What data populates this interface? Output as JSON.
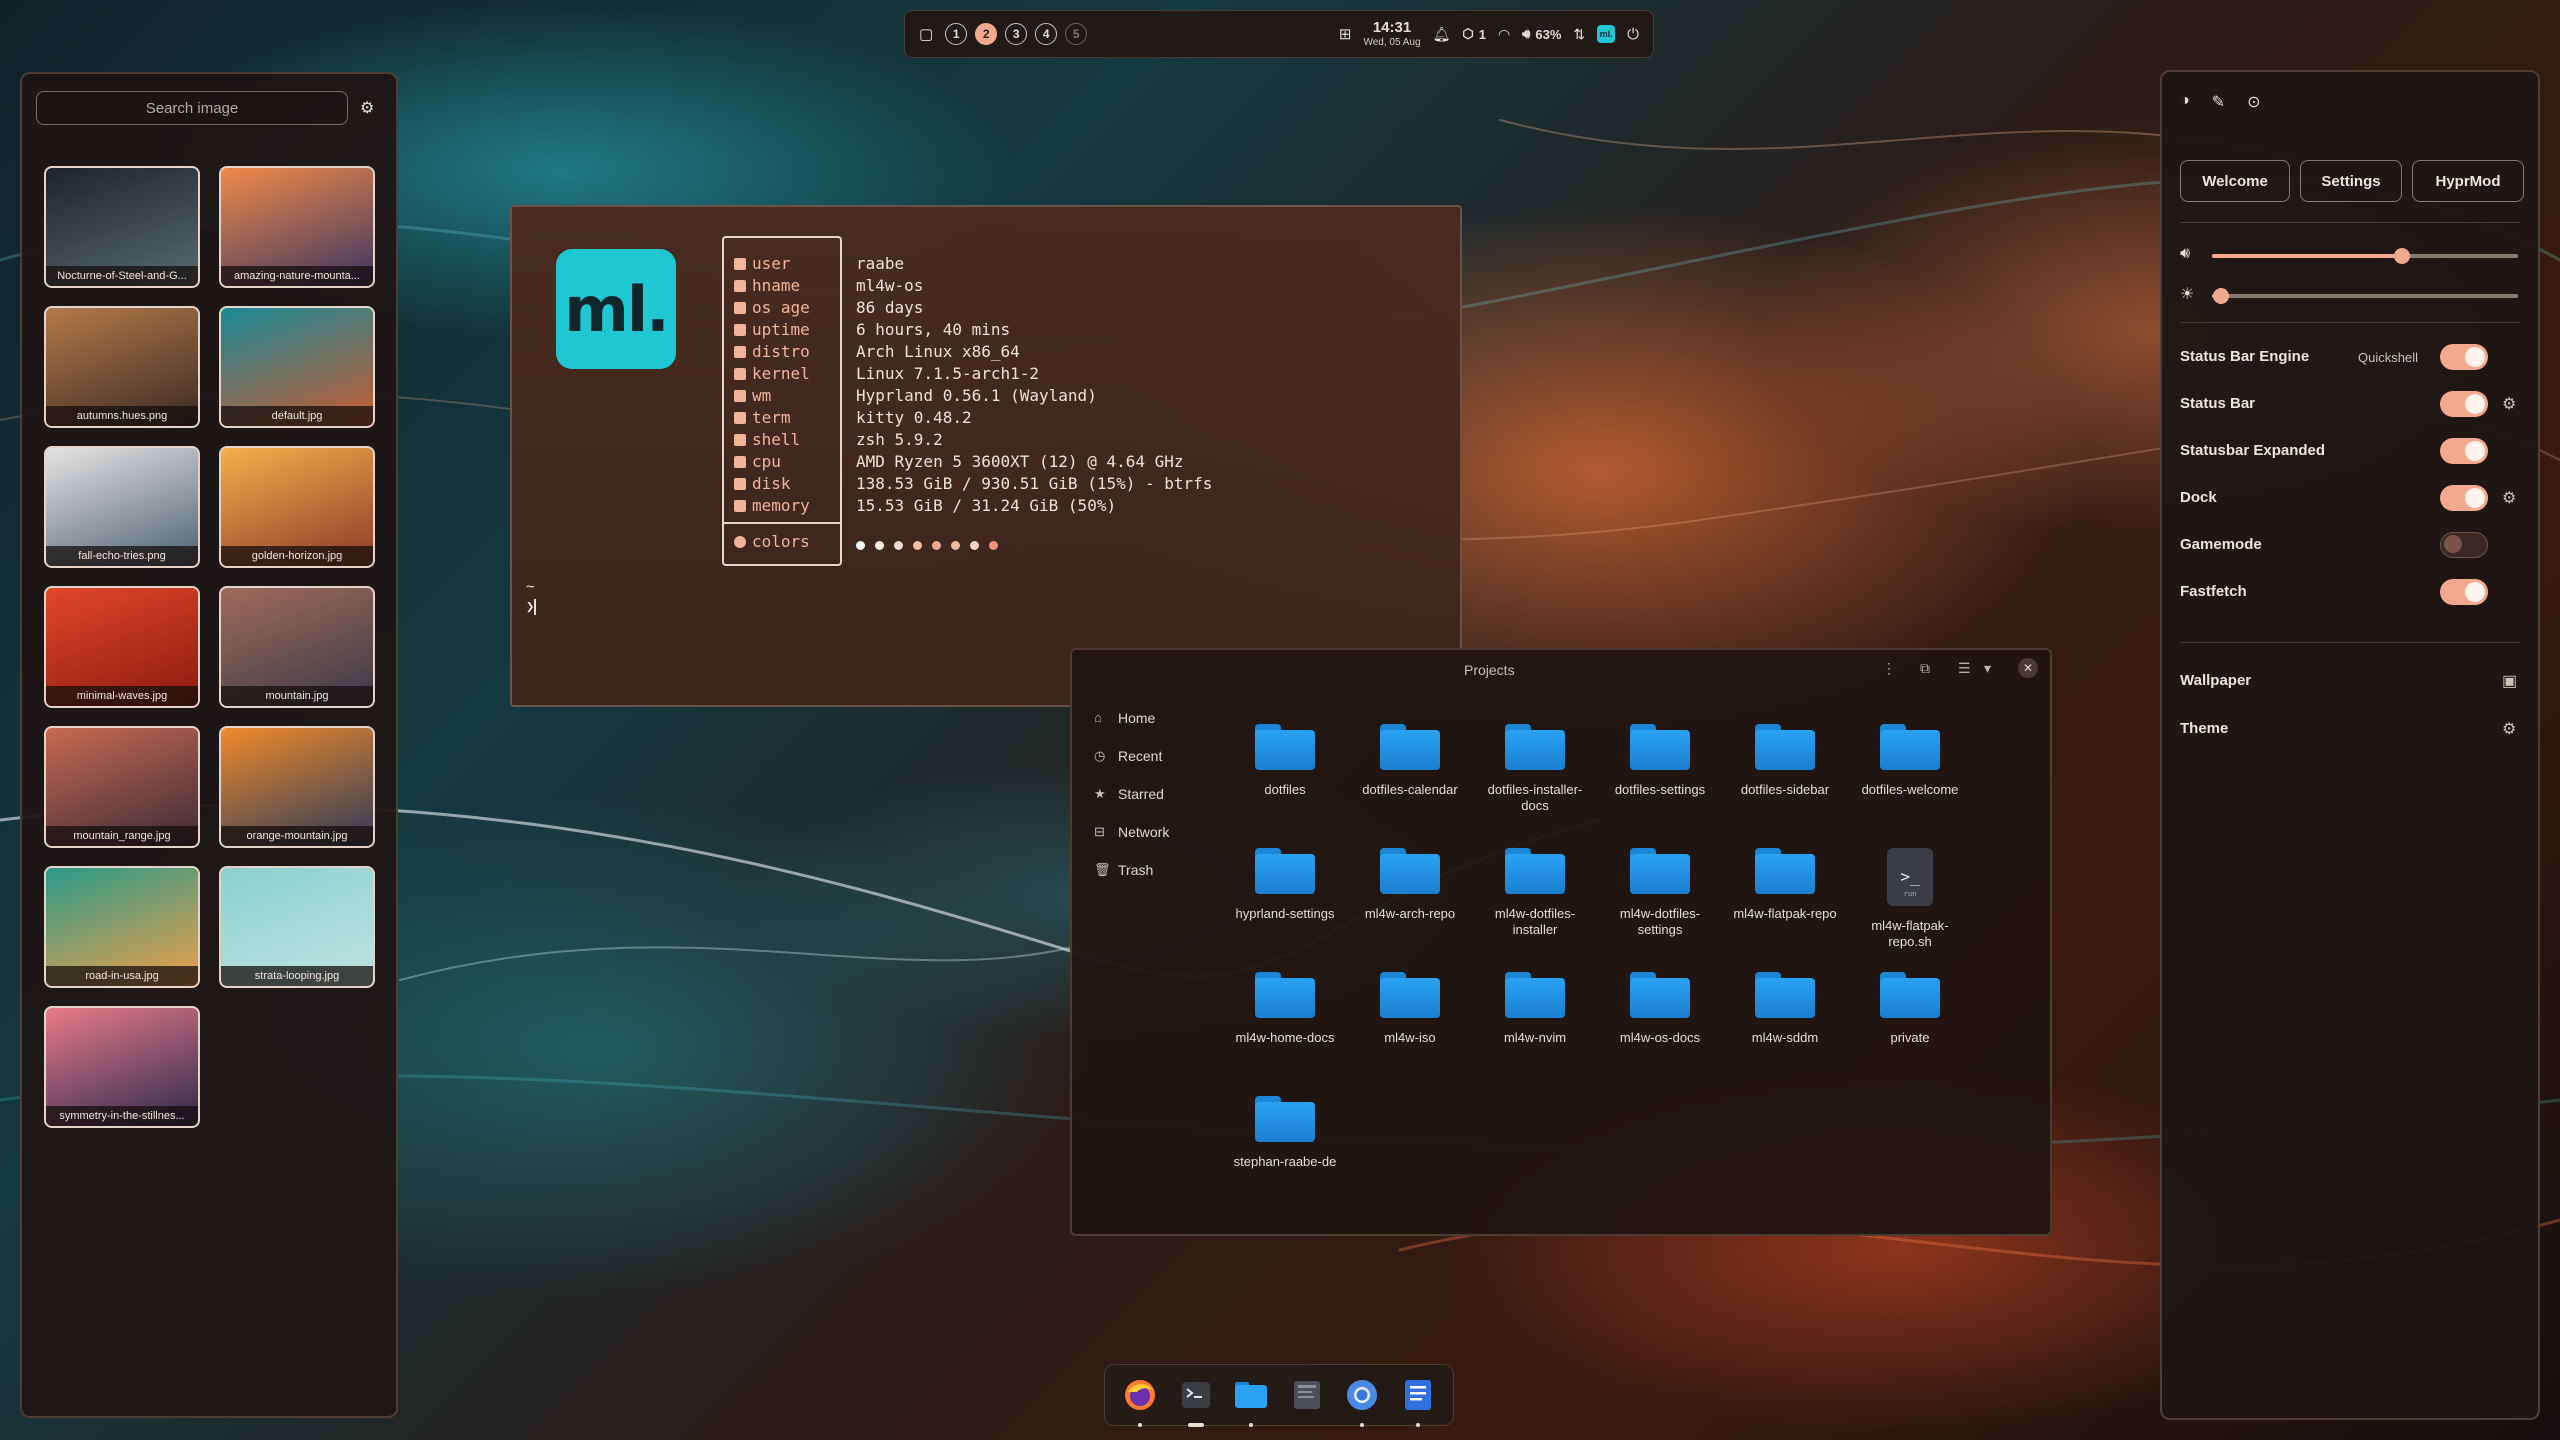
{
  "topbar": {
    "workspaces": [
      "1",
      "2",
      "3",
      "4",
      "5"
    ],
    "active_workspace": "2",
    "time": "14:31",
    "date": "Wed, 05 Aug",
    "updates": "1",
    "volume": "63%",
    "icons": [
      "window-icon",
      "apps-grid-icon",
      "bell-icon",
      "package-icon",
      "gauge-icon",
      "speaker-icon",
      "network-icon",
      "ml-logo-icon",
      "power-icon"
    ]
  },
  "wallpapers": {
    "search_placeholder": "Search image",
    "items": [
      {
        "name": "Nocturne-of-Steel-and-G...",
        "colors": [
          "#1d2428",
          "#5a6a72"
        ]
      },
      {
        "name": "amazing-nature-mounta...",
        "colors": [
          "#f08a4a",
          "#3b3560"
        ]
      },
      {
        "name": "autumns.hues.png",
        "colors": [
          "#b47a4a",
          "#3b2a22"
        ]
      },
      {
        "name": "default.jpg",
        "colors": [
          "#1a8a96",
          "#c85a30"
        ]
      },
      {
        "name": "fall-echo-tries.png",
        "colors": [
          "#e6e4e2",
          "#4e6070"
        ]
      },
      {
        "name": "golden-horizon.jpg",
        "colors": [
          "#f5b04a",
          "#8a3a2a"
        ]
      },
      {
        "name": "minimal-waves.jpg",
        "colors": [
          "#e2462a",
          "#8a1a10"
        ]
      },
      {
        "name": "mountain.jpg",
        "colors": [
          "#a06a5a",
          "#3a3a48"
        ]
      },
      {
        "name": "mountain_range.jpg",
        "colors": [
          "#c86a50",
          "#3a2a38"
        ]
      },
      {
        "name": "orange-mountain.jpg",
        "colors": [
          "#f08a2a",
          "#2a3a5a"
        ]
      },
      {
        "name": "road-in-usa.jpg",
        "colors": [
          "#2a9a88",
          "#f0a04a"
        ]
      },
      {
        "name": "strata-looping.jpg",
        "colors": [
          "#8ad0d0",
          "#c0e4e0"
        ]
      },
      {
        "name": "symmetry-in-the-stillnes...",
        "colors": [
          "#e87a8a",
          "#2a2a4a"
        ]
      }
    ]
  },
  "terminal": {
    "logo": "ml.",
    "fields": [
      {
        "key": "user",
        "value": "raabe"
      },
      {
        "key": "hname",
        "value": "ml4w-os"
      },
      {
        "key": "os age",
        "value": "86 days"
      },
      {
        "key": "uptime",
        "value": "6 hours, 40 mins"
      },
      {
        "key": "distro",
        "value": "Arch Linux x86_64"
      },
      {
        "key": "kernel",
        "value": "Linux 7.1.5-arch1-2"
      },
      {
        "key": "wm",
        "value": "Hyprland 0.56.1 (Wayland)"
      },
      {
        "key": "term",
        "value": "kitty 0.48.2"
      },
      {
        "key": "shell",
        "value": "zsh 5.9.2"
      },
      {
        "key": "cpu",
        "value": "AMD Ryzen 5 3600XT (12) @ 4.64 GHz"
      },
      {
        "key": "disk",
        "value": "138.53 GiB / 930.51 GiB (15%) - btrfs"
      },
      {
        "key": "memory",
        "value": "15.53 GiB / 31.24 GiB (50%)"
      }
    ],
    "colors_label": "colors",
    "palette": [
      "#ffffff",
      "#f6ece6",
      "#f3d8cc",
      "#f2bca6",
      "#efa990",
      "#f2b8a2",
      "#f6d2c4",
      "#ee9580"
    ],
    "prompt_dir": "~",
    "prompt_symbol": "❯"
  },
  "filemanager": {
    "title": "Projects",
    "sidebar": [
      "Home",
      "Recent",
      "Starred",
      "Network",
      "Trash"
    ],
    "items": [
      {
        "label": "dotfiles",
        "type": "folder"
      },
      {
        "label": "dotfiles-calendar",
        "type": "folder"
      },
      {
        "label": "dotfiles-installer-docs",
        "type": "folder"
      },
      {
        "label": "dotfiles-settings",
        "type": "folder"
      },
      {
        "label": "dotfiles-sidebar",
        "type": "folder"
      },
      {
        "label": "dotfiles-welcome",
        "type": "folder"
      },
      {
        "label": "hyprland-settings",
        "type": "folder"
      },
      {
        "label": "ml4w-arch-repo",
        "type": "folder"
      },
      {
        "label": "ml4w-dotfiles-installer",
        "type": "folder"
      },
      {
        "label": "ml4w-dotfiles-settings",
        "type": "folder"
      },
      {
        "label": "ml4w-flatpak-repo",
        "type": "folder"
      },
      {
        "label": "ml4w-flatpak-repo.sh",
        "type": "script"
      },
      {
        "label": "ml4w-home-docs",
        "type": "folder"
      },
      {
        "label": "ml4w-iso",
        "type": "folder"
      },
      {
        "label": "ml4w-nvim",
        "type": "folder"
      },
      {
        "label": "ml4w-os-docs",
        "type": "folder"
      },
      {
        "label": "ml4w-sddm",
        "type": "folder"
      },
      {
        "label": "private",
        "type": "folder"
      },
      {
        "label": "stephan-raabe-de",
        "type": "folder"
      }
    ],
    "script_badge": "run"
  },
  "settings": {
    "tabs": [
      "Welcome",
      "Settings",
      "HyprMod"
    ],
    "volume_fraction": 0.62,
    "brightness_fraction": 0.03,
    "rows": [
      {
        "label": "Status Bar Engine",
        "extra": "Quickshell",
        "on": true,
        "gear": false
      },
      {
        "label": "Status Bar",
        "extra": "",
        "on": true,
        "gear": true
      },
      {
        "label": "Statusbar Expanded",
        "extra": "",
        "on": true,
        "gear": false
      },
      {
        "label": "Dock",
        "extra": "",
        "on": true,
        "gear": true
      },
      {
        "label": "Gamemode",
        "extra": "",
        "on": false,
        "gear": false
      },
      {
        "label": "Fastfetch",
        "extra": "",
        "on": true,
        "gear": false
      }
    ],
    "links": [
      {
        "label": "Wallpaper",
        "icon": "wallpaper-icon"
      },
      {
        "label": "Theme",
        "icon": "gear-icon"
      }
    ]
  },
  "dock": {
    "apps": [
      "firefox-icon",
      "terminal-icon",
      "files-icon",
      "text-editor-icon",
      "chromium-icon",
      "notes-icon"
    ]
  },
  "colors": {
    "accent": "#f2a98e",
    "logo": "#1ec7d2",
    "folder": "#2aa2f2"
  }
}
